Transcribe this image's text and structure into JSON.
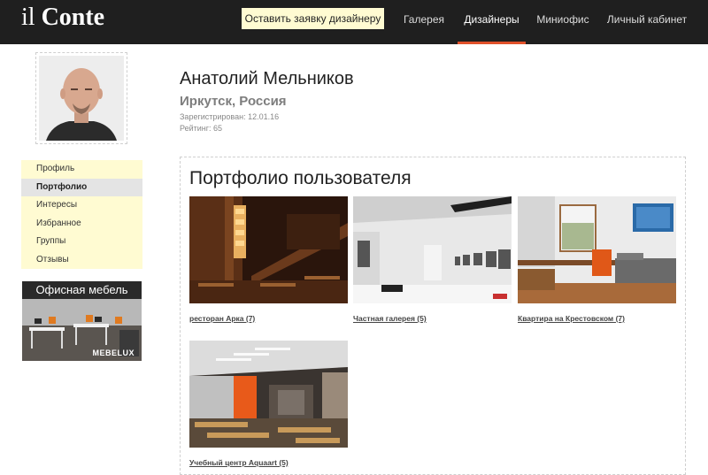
{
  "header": {
    "logo_prefix": "il",
    "logo_main": "Conte",
    "cta_label": "Оставить заявку дизайнеру",
    "nav": [
      {
        "label": "Галерея",
        "active": false
      },
      {
        "label": "Дизайнеры",
        "active": true
      },
      {
        "label": "Миниофис",
        "active": false
      },
      {
        "label": "Личный кабинет",
        "active": false
      }
    ],
    "accent_color": "#e0512a"
  },
  "profile": {
    "name": "Анатолий Мельников",
    "location": "Иркутск, Россия",
    "registered": "Зарегистрирован: 12.01.16",
    "rating": "Рейтинг: 65"
  },
  "sidebar": {
    "items": [
      {
        "label": "Профиль",
        "active": false
      },
      {
        "label": "Портфолио",
        "active": true
      },
      {
        "label": "Интересы",
        "active": false
      },
      {
        "label": "Избранное",
        "active": false
      },
      {
        "label": "Группы",
        "active": false
      },
      {
        "label": "Отзывы",
        "active": false
      }
    ],
    "banner_title": "Офисная мебель",
    "banner_brand": "MEBELUX"
  },
  "portfolio": {
    "title": "Портфолио пользователя",
    "items": [
      {
        "caption": "ресторан Арка (7)"
      },
      {
        "caption": "Частная галерея (5)"
      },
      {
        "caption": "Квартира на Крестовском (7)"
      },
      {
        "caption": "Учебный центр Aquaart (5)"
      }
    ]
  }
}
